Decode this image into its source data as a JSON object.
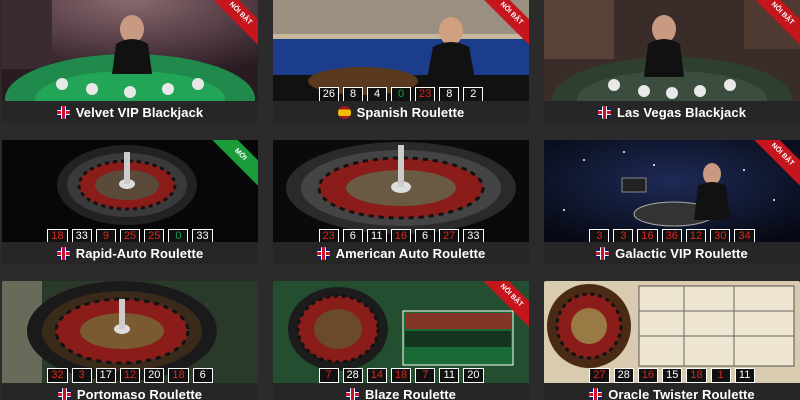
{
  "games": [
    {
      "name": "Velvet VIP Blackjack",
      "flag": "uk",
      "badge": "NỔI BẬT",
      "badge_color": "#c4161c",
      "results": []
    },
    {
      "name": "Spanish Roulette",
      "flag": "es",
      "badge": "NỔI BẬT",
      "badge_color": "#c4161c",
      "results": [
        {
          "v": "26",
          "c": "black"
        },
        {
          "v": "8",
          "c": "black"
        },
        {
          "v": "4",
          "c": "black"
        },
        {
          "v": "0",
          "c": "green"
        },
        {
          "v": "23",
          "c": "red"
        },
        {
          "v": "8",
          "c": "black"
        },
        {
          "v": "2",
          "c": "black"
        }
      ]
    },
    {
      "name": "Las Vegas Blackjack",
      "flag": "uk",
      "badge": "NỔI BẬT",
      "badge_color": "#c4161c",
      "results": []
    },
    {
      "name": "Rapid-Auto Roulette",
      "flag": "uk",
      "badge": "MỚI",
      "badge_color": "#1a9c3a",
      "results": [
        {
          "v": "18",
          "c": "red"
        },
        {
          "v": "33",
          "c": "black"
        },
        {
          "v": "9",
          "c": "red"
        },
        {
          "v": "25",
          "c": "red"
        },
        {
          "v": "25",
          "c": "red"
        },
        {
          "v": "0",
          "c": "green"
        },
        {
          "v": "33",
          "c": "black"
        }
      ]
    },
    {
      "name": "American Auto Roulette",
      "flag": "uk",
      "badge": "",
      "badge_color": "",
      "results": [
        {
          "v": "23",
          "c": "red"
        },
        {
          "v": "6",
          "c": "black"
        },
        {
          "v": "11",
          "c": "black"
        },
        {
          "v": "16",
          "c": "red"
        },
        {
          "v": "6",
          "c": "black"
        },
        {
          "v": "27",
          "c": "red"
        },
        {
          "v": "33",
          "c": "black"
        }
      ]
    },
    {
      "name": "Galactic VIP Roulette",
      "flag": "uk",
      "badge": "NỔI BẬT",
      "badge_color": "#c4161c",
      "results": [
        {
          "v": "3",
          "c": "red"
        },
        {
          "v": "3",
          "c": "red"
        },
        {
          "v": "16",
          "c": "red"
        },
        {
          "v": "36",
          "c": "red"
        },
        {
          "v": "12",
          "c": "red"
        },
        {
          "v": "30",
          "c": "red"
        },
        {
          "v": "34",
          "c": "red"
        }
      ]
    },
    {
      "name": "Portomaso Roulette",
      "flag": "uk",
      "badge": "",
      "badge_color": "",
      "results": [
        {
          "v": "32",
          "c": "red"
        },
        {
          "v": "3",
          "c": "red"
        },
        {
          "v": "17",
          "c": "black"
        },
        {
          "v": "12",
          "c": "red"
        },
        {
          "v": "20",
          "c": "black"
        },
        {
          "v": "18",
          "c": "red"
        },
        {
          "v": "6",
          "c": "black"
        }
      ]
    },
    {
      "name": "Blaze Roulette",
      "flag": "uk",
      "badge": "NỔI BẬT",
      "badge_color": "#c4161c",
      "results": [
        {
          "v": "7",
          "c": "red"
        },
        {
          "v": "28",
          "c": "black"
        },
        {
          "v": "14",
          "c": "red"
        },
        {
          "v": "18",
          "c": "red"
        },
        {
          "v": "7",
          "c": "red"
        },
        {
          "v": "11",
          "c": "black"
        },
        {
          "v": "20",
          "c": "black"
        }
      ]
    },
    {
      "name": "Oracle Twister Roulette",
      "flag": "uk",
      "badge": "",
      "badge_color": "",
      "results": [
        {
          "v": "27",
          "c": "red"
        },
        {
          "v": "28",
          "c": "black"
        },
        {
          "v": "16",
          "c": "red"
        },
        {
          "v": "15",
          "c": "black"
        },
        {
          "v": "18",
          "c": "red"
        },
        {
          "v": "1",
          "c": "red"
        },
        {
          "v": "11",
          "c": "black"
        }
      ]
    }
  ]
}
